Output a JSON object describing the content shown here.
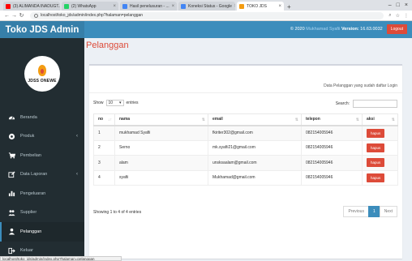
{
  "browser": {
    "tabs": [
      {
        "title": "(3) ALIMANDA INADUGT...",
        "color": "#ff0000",
        "active": false
      },
      {
        "title": "(2) WhatsApp",
        "color": "#25d366",
        "active": false
      },
      {
        "title": "Hasil penelusuran - ...",
        "color": "#4285f4",
        "active": false
      },
      {
        "title": "Koneksi Status - Google",
        "color": "#4285f4",
        "active": false
      },
      {
        "title": "TOKO JDS",
        "color": "#f39c12",
        "active": true
      }
    ],
    "url": "localhost/toko_jds/admin/index.php?halaman=pelanggan",
    "status_url": "localhost/toko_jds/admin/index.php?halaman=pelanggan"
  },
  "header": {
    "app_title": "Toko JDS Admin",
    "copyright": "© 2020",
    "user_name": "Mukhamad Syafii",
    "version_label": "Version:",
    "version_value": "16.63.0032",
    "logout_label": "Logout"
  },
  "sidebar": {
    "brand_text": "JDSS ONEWE",
    "items": [
      {
        "label": "Beranda",
        "icon": "dashboard-icon",
        "has_chevron": false,
        "active": false
      },
      {
        "label": "Produk",
        "icon": "product-icon",
        "has_chevron": true,
        "active": false
      },
      {
        "label": "Pembelian",
        "icon": "cart-icon",
        "has_chevron": false,
        "active": false
      },
      {
        "label": "Data Laporan",
        "icon": "edit-icon",
        "has_chevron": true,
        "active": false
      },
      {
        "label": "Pengeluaran",
        "icon": "bar-chart-icon",
        "has_chevron": false,
        "active": false
      },
      {
        "label": "Supplier",
        "icon": "users-icon",
        "has_chevron": false,
        "active": false
      },
      {
        "label": "Pelanggan",
        "icon": "user-icon",
        "has_chevron": false,
        "active": true
      },
      {
        "label": "Keluar",
        "icon": "sign-out-icon",
        "has_chevron": false,
        "active": false
      }
    ]
  },
  "main": {
    "title": "Pelanggan",
    "subtitle": "Data Pelanggan yang sudah daftar Login",
    "show_label": "Show",
    "show_value": "10",
    "entries_label": "entries",
    "search_label": "Search:",
    "columns": [
      "no",
      "nama",
      "email",
      "telepon",
      "aksi"
    ],
    "rows": [
      {
        "no": "1",
        "nama": "mukhamad Syafii",
        "email": "fkiriter302@gmail.com",
        "telepon": "082154005946",
        "aksi": "hapus"
      },
      {
        "no": "2",
        "nama": "Serno",
        "email": "mk.syafii21@gmail.com",
        "telepon": "082154005946",
        "aksi": "hapus"
      },
      {
        "no": "3",
        "nama": "alam",
        "email": "unsksaalam@gmail.com",
        "telepon": "082154005946",
        "aksi": "hapus"
      },
      {
        "no": "4",
        "nama": "syafii",
        "email": "Mukhamad@gmail.com",
        "telepon": "082154005946",
        "aksi": "hapus"
      }
    ],
    "info": "Showing 1 to 4 of 4 entries",
    "pager": {
      "previous": "Previous",
      "current": "1",
      "next": "Next"
    }
  }
}
